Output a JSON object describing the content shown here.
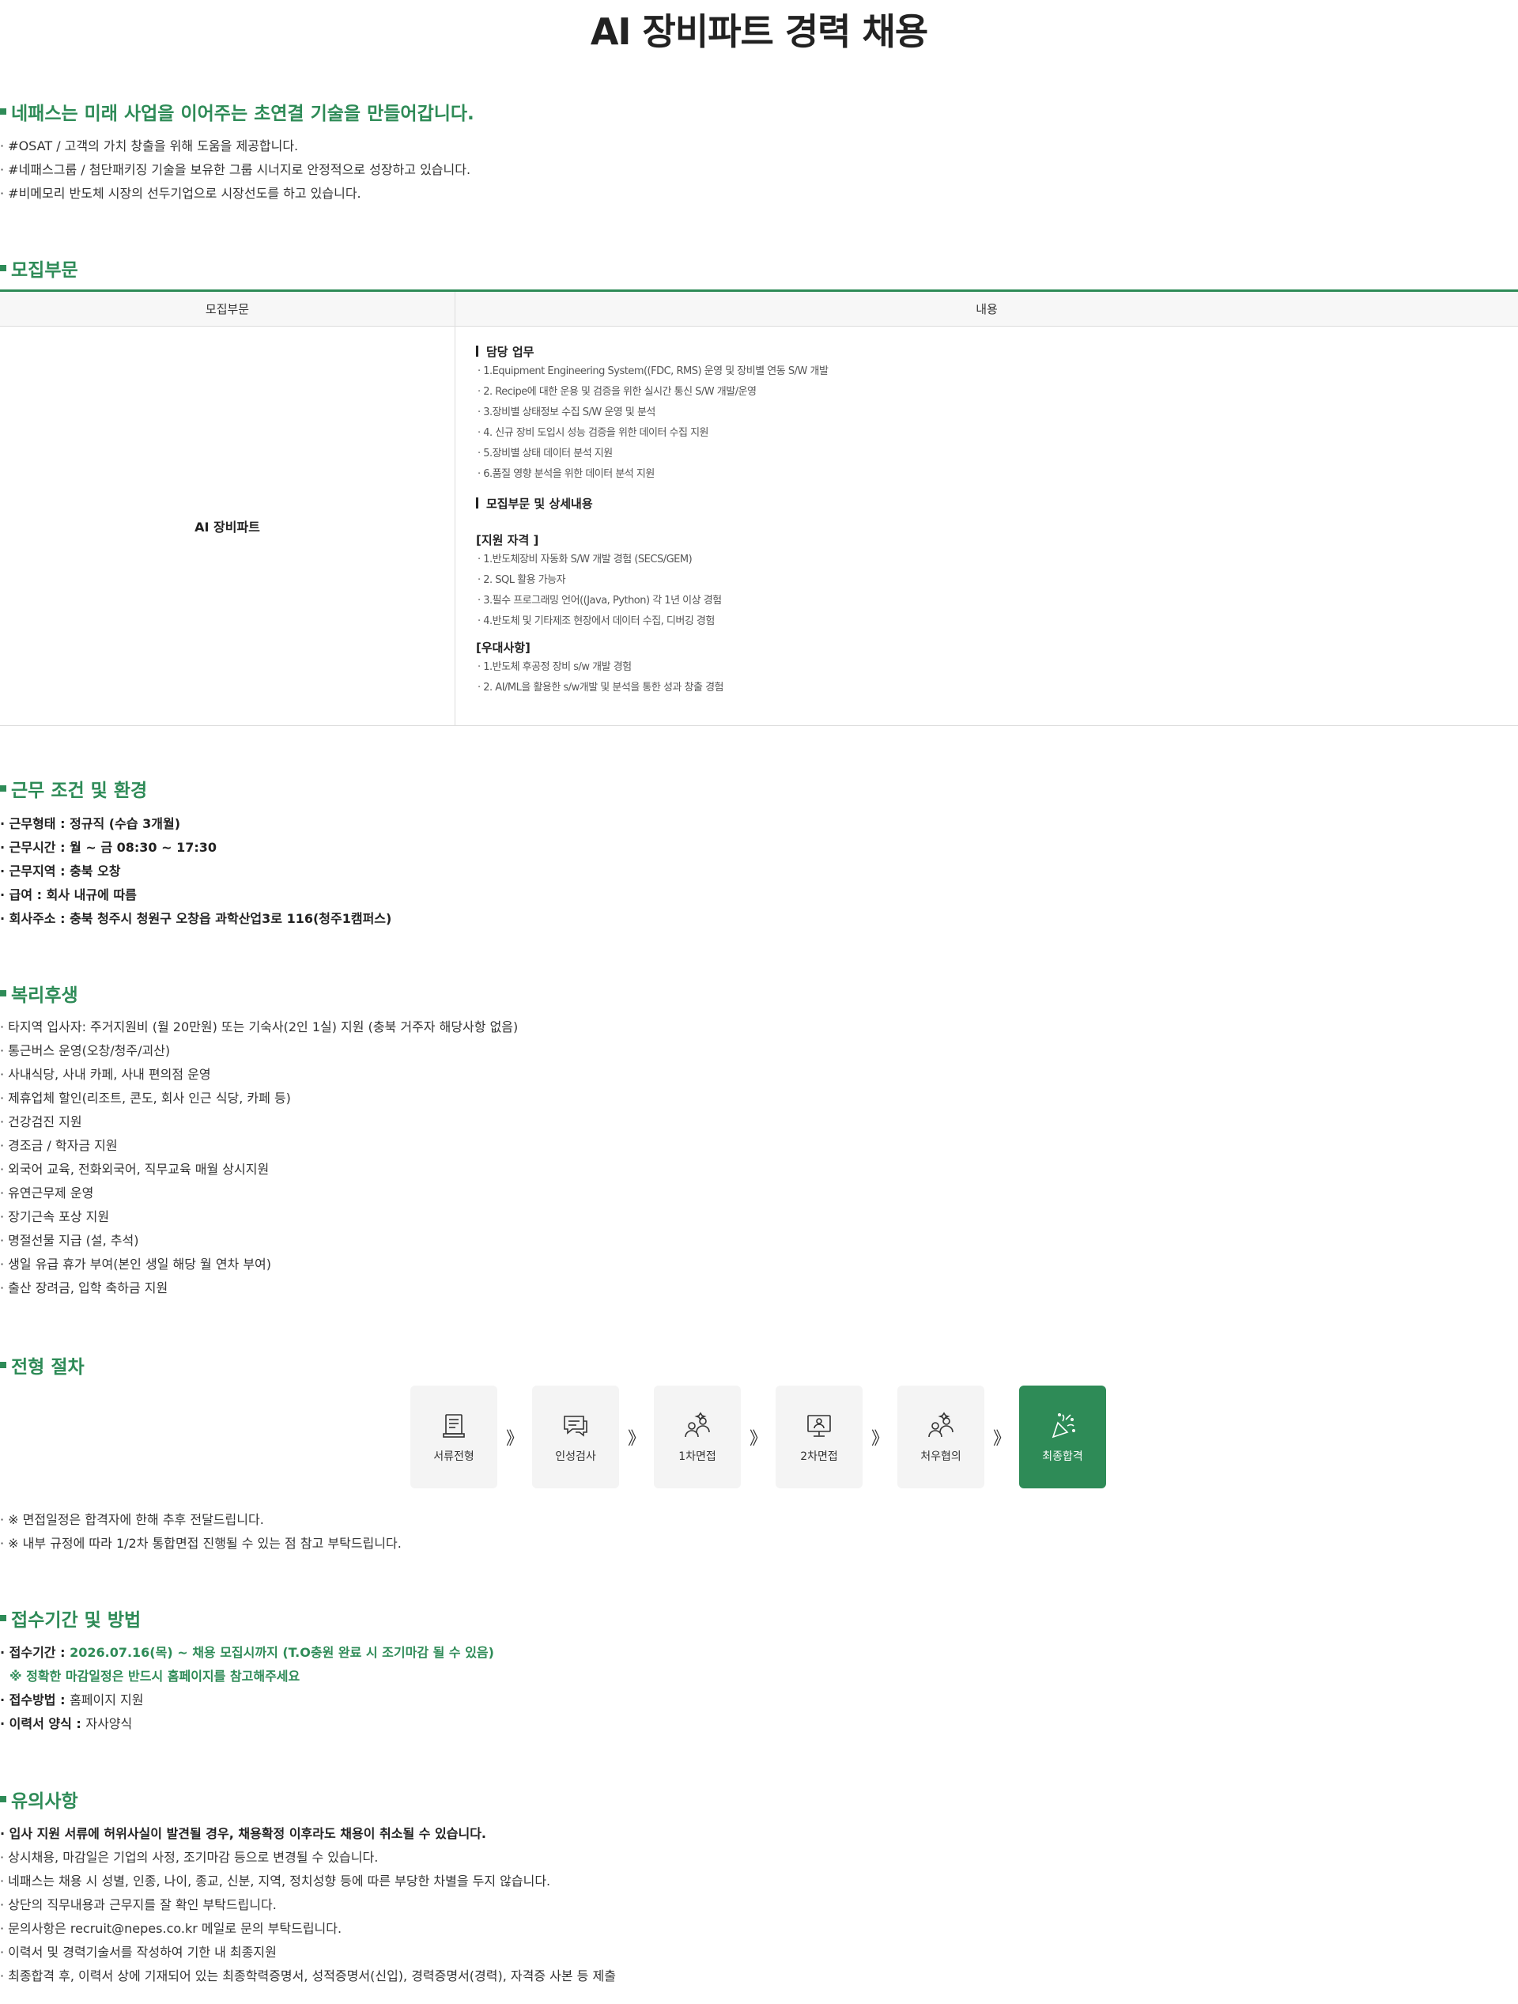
{
  "title": "AI 장비파트 경력 채용",
  "intro": {
    "heading": "네패스는 미래 사업을 이어주는 초연결 기술을 만들어갑니다.",
    "lines": [
      "· #OSAT / 고객의 가치 창출을 위해 도움을 제공합니다.",
      "· #네패스그룹 / 첨단패키징 기술을 보유한 그룹 시너지로 안정적으로 성장하고 있습니다.",
      "· #비메모리 반도체 시장의 선두기업으로 시장선도를 하고 있습니다."
    ]
  },
  "recruit": {
    "heading": "모집부문",
    "col1": "모집부문",
    "col2": "내용",
    "part": "AI 장비파트",
    "duty_title": "담당 업무",
    "duties": [
      "· 1.Equipment Engineering System((FDC, RMS) 운영 및 장비별 연동 S/W 개발",
      "· 2. Recipe에 대한 운용 및 검증을 위한 실시간 통신 S/W 개발/운영",
      "· 3.장비별 상태정보 수집 S/W 운영 및 분석",
      "· 4. 신규 장비 도입시 성능 검증을 위한 데이터 수집 지원",
      "· 5.장비별 상태 데이터 분석 지원",
      "· 6.품질 영향 분석을 위한 데이터 분석 지원"
    ],
    "detail_title": "모집부문 및 상세내용",
    "qual_title": "[지원 자격 ]",
    "quals": [
      "· 1.반도체장비 자동화 S/W 개발 경험 (SECS/GEM)",
      "· 2. SQL 활용 가능자",
      "· 3.필수 프로그래밍 언어((Java, Python) 각 1년 이상 경험",
      "· 4.반도체 및 기타제조 현장에서 데이터 수집, 디버깅 경험"
    ],
    "pref_title": "[우대사항]",
    "prefs": [
      "· 1.반도체 후공정 장비 s/w 개발 경험",
      "· 2. AI/ML을 활용한 s/w개발 및 분석을 통한 성과 창출 경험"
    ]
  },
  "conditions": {
    "heading": "근무 조건 및 환경",
    "lines": [
      "· 근무형태 : 정규직 (수습 3개월)",
      "· 근무시간 : 월 ~ 금 08:30 ~ 17:30",
      "· 근무지역 : 충북 오창",
      "· 급여 : 회사 내규에 따름",
      "· 회사주소 : 충북 청주시 청원구 오창읍 과학산업3로 116(청주1캠퍼스)"
    ]
  },
  "welfare": {
    "heading": "복리후생",
    "lines": [
      "· 타지역 입사자: 주거지원비 (월 20만원) 또는 기숙사(2인 1실) 지원 (충북 거주자 해당사항 없음)",
      "· 통근버스 운영(오창/청주/괴산)",
      "· 사내식당, 사내 카페, 사내 편의점 운영",
      "· 제휴업체 할인(리조트, 콘도, 회사 인근 식당, 카페 등)",
      "· 건강검진 지원",
      "· 경조금 / 학자금 지원",
      "· 외국어 교육, 전화외국어, 직무교육 매월 상시지원",
      "· 유연근무제 운영",
      "· 장기근속 포상 지원",
      "· 명절선물 지급 (설, 추석)",
      "· 생일 유급 휴가 부여(본인 생일 해당 월 연차 부여)",
      "· 출산 장려금, 입학 축하금 지원"
    ]
  },
  "process": {
    "heading": "전형 절차",
    "steps": [
      {
        "label": "서류전형",
        "icon": "document-icon"
      },
      {
        "label": "인성검사",
        "icon": "chat-icon"
      },
      {
        "label": "1차면접",
        "icon": "people-icon"
      },
      {
        "label": "2차면접",
        "icon": "monitor-person-icon"
      },
      {
        "label": "처우협의",
        "icon": "people-icon"
      },
      {
        "label": "최종합격",
        "icon": "party-popper-icon"
      }
    ],
    "arrow": "》",
    "notes": [
      "· ※ 면접일정은 합격자에 한해 추후 전달드립니다.",
      "· ※ 내부 규정에 따라 1/2차 통합면접 진행될 수 있는 점 참고 부탁드립니다."
    ],
    "accent": "#2e8b57"
  },
  "apply": {
    "heading": "접수기간 및 방법",
    "period_label": "· 접수기간 : ",
    "period_value": "2026.07.16(목) ~ 채용 모집시까지 (T.O충원 완료 시 조기마감 될 수 있음)",
    "period_note": "※ 정확한 마감일정은 반드시 홈페이지를 참고해주세요",
    "method_label": "· 접수방법 : ",
    "method_value": "홈페이지 지원",
    "form_label": "· 이력서 양식 : ",
    "form_value": "자사양식"
  },
  "notice": {
    "heading": "유의사항",
    "bold_line": "· 입사 지원 서류에 허위사실이 발견될 경우, 채용확정 이후라도 채용이 취소될 수 있습니다.",
    "lines": [
      "· 상시채용, 마감일은 기업의 사정, 조기마감 등으로 변경될 수 있습니다.",
      "· 네패스는 채용 시 성별, 인종, 나이, 종교, 신분, 지역, 정치성향 등에 따른 부당한 차별을 두지 않습니다.",
      "· 상단의 직무내용과 근무지를 잘 확인 부탁드립니다.",
      "· 문의사항은 recruit@nepes.co.kr 메일로 문의 부탁드립니다.",
      "· 이력서 및 경력기술서를 작성하여 기한 내 최종지원",
      "· 최종합격 후, 이력서 상에 기재되어 있는 최종학력증명서, 성적증명서(신입), 경력증명서(경력), 자격증 사본 등 제출"
    ]
  }
}
